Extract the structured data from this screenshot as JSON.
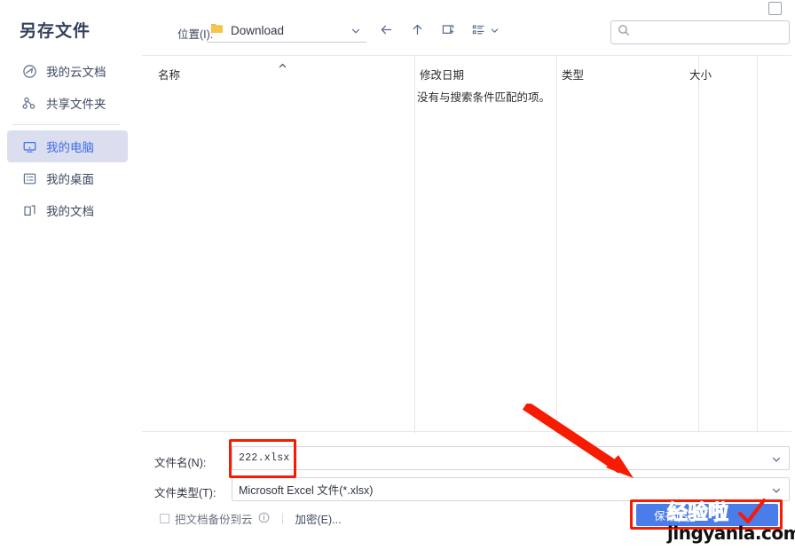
{
  "window": {
    "title": "另存文件",
    "maximize_icon": "square-restore-icon"
  },
  "sidebar": {
    "items": [
      {
        "label": "我的云文档",
        "icon": "cloud-icon",
        "selected": false
      },
      {
        "label": "共享文件夹",
        "icon": "share-nodes-icon",
        "selected": false
      },
      {
        "label": "我的电脑",
        "icon": "monitor-icon",
        "selected": true
      },
      {
        "label": "我的桌面",
        "icon": "desktop-icon",
        "selected": false
      },
      {
        "label": "我的文档",
        "icon": "folder-docs-icon",
        "selected": false
      }
    ]
  },
  "toolbar": {
    "location_label": "位置(I):",
    "location_value": "Download",
    "location_icon": "folder-icon",
    "location_caret": "chevron-down-icon",
    "back_icon": "arrow-left-icon",
    "up_icon": "arrow-up-icon",
    "new_folder_icon": "new-folder-icon",
    "view_icon": "view-list-icon",
    "view_caret": "chevron-down-icon"
  },
  "search": {
    "icon": "search-icon",
    "value": "",
    "placeholder": ""
  },
  "file_list": {
    "columns": [
      {
        "label": "名称",
        "sort": "ascending",
        "sort_icon": "caret-up-icon"
      },
      {
        "label": "修改日期"
      },
      {
        "label": "类型"
      },
      {
        "label": "大小"
      }
    ],
    "empty_message": "没有与搜索条件匹配的项。",
    "rows": []
  },
  "form": {
    "filename_label": "文件名(N):",
    "filename_value": "222.xlsx",
    "filename_caret": "chevron-down-icon",
    "filetype_label": "文件类型(T):",
    "filetype_value": "Microsoft Excel 文件(*.xlsx)",
    "filetype_caret": "chevron-down-icon",
    "backup_checkbox_label": "把文档备份到云",
    "backup_checked": false,
    "info_icon": "info-circle-icon",
    "encrypt_label": "加密(E)..."
  },
  "actions": {
    "save_label": "保存(S)"
  },
  "annotations": {
    "arrow_icon": "red-arrow-icon",
    "highlight_color": "#f71b02"
  },
  "watermark": {
    "brand": "经验啦",
    "domain": "jingyanla.com",
    "check_icon": "red-check-icon"
  },
  "colors": {
    "accent": "#4a7dea",
    "selected_bg": "#dbdeee",
    "title": "#33415c",
    "annotation_red": "#f71b02"
  }
}
